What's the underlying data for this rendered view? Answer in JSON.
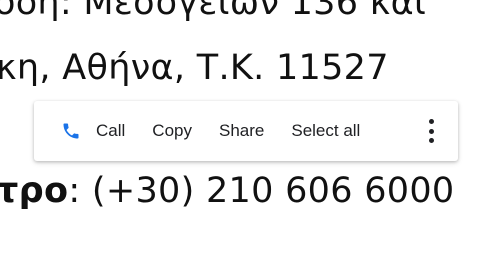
{
  "document": {
    "line1": "οδη: Μεσογείων 136 και",
    "line2": "κη, Αθήνα, Τ.Κ. 11527",
    "line3_label": "τρο",
    "line3_value": ": (+30) 210 606 6000"
  },
  "selection_toolbar": {
    "icon": "phone-icon",
    "call_label": "Call",
    "copy_label": "Copy",
    "share_label": "Share",
    "select_all_label": "Select all",
    "more_icon": "more-vert-icon"
  },
  "colors": {
    "phone_icon": "#1a73e8",
    "text": "#111111",
    "toolbar_text": "#202124"
  }
}
